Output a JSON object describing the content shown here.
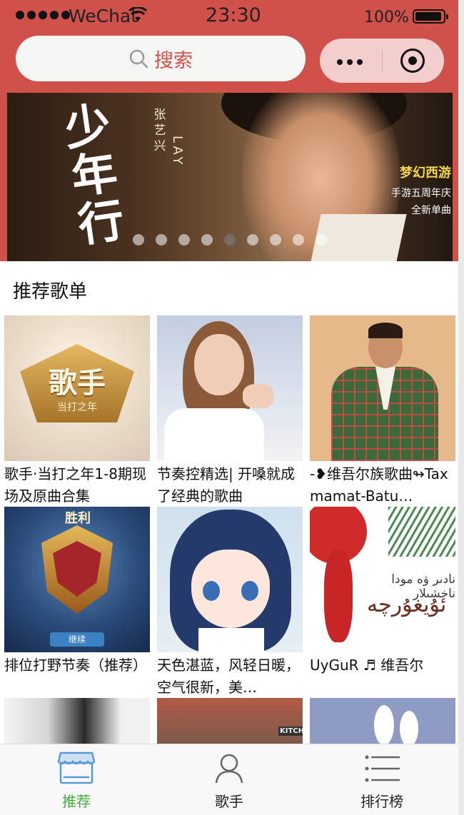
{
  "status_bar": {
    "carrier": "WeChat",
    "time": "23:30",
    "battery": "100%"
  },
  "search": {
    "label": "搜索",
    "icon": "search-icon"
  },
  "capsule": {
    "more_icon": "more-icon",
    "close_icon": "target-icon"
  },
  "banner": {
    "title": "少年行",
    "artist_cn": "张艺兴",
    "artist_en": "LAY",
    "logo": "梦幻西游",
    "promo_line1": "手游五周年庆",
    "promo_line2": "全新单曲",
    "page_count": 9,
    "active_page": 4
  },
  "section": {
    "title": "推荐歌单"
  },
  "playlists": [
    {
      "title": "歌手·当打之年1-8期现场及原曲合集",
      "cover_text": "歌手",
      "cover_sub": "当打之年"
    },
    {
      "title": "节奏控精选| 开嗓就成了经典的歌曲"
    },
    {
      "title": "-❥维吾尔族歌曲↬Taxmamat-Batu…"
    },
    {
      "title": "排位打野节奏（推荐）",
      "cover_text": "胜利",
      "cover_button": "继续"
    },
    {
      "title": "天色湛蓝，风轻日暖，空气很新，美…"
    },
    {
      "title": "UyGuR ♬ 维吾尔",
      "cover_line1": "نادىر ۋە مودا ناخشىلار",
      "cover_line2": "ئۇيغۇرچە"
    },
    {
      "title": ""
    },
    {
      "title": "",
      "cover_text": "KITCH"
    },
    {
      "title": ""
    }
  ],
  "tabbar": {
    "tabs": [
      {
        "label": "推荐",
        "icon": "store-icon",
        "active": true
      },
      {
        "label": "歌手",
        "icon": "person-icon",
        "active": false
      },
      {
        "label": "排行榜",
        "icon": "list-icon",
        "active": false
      }
    ]
  },
  "colors": {
    "header_red": "#d0514a",
    "active_green": "#3daf3a",
    "tab_blue": "#5b9bd5"
  }
}
